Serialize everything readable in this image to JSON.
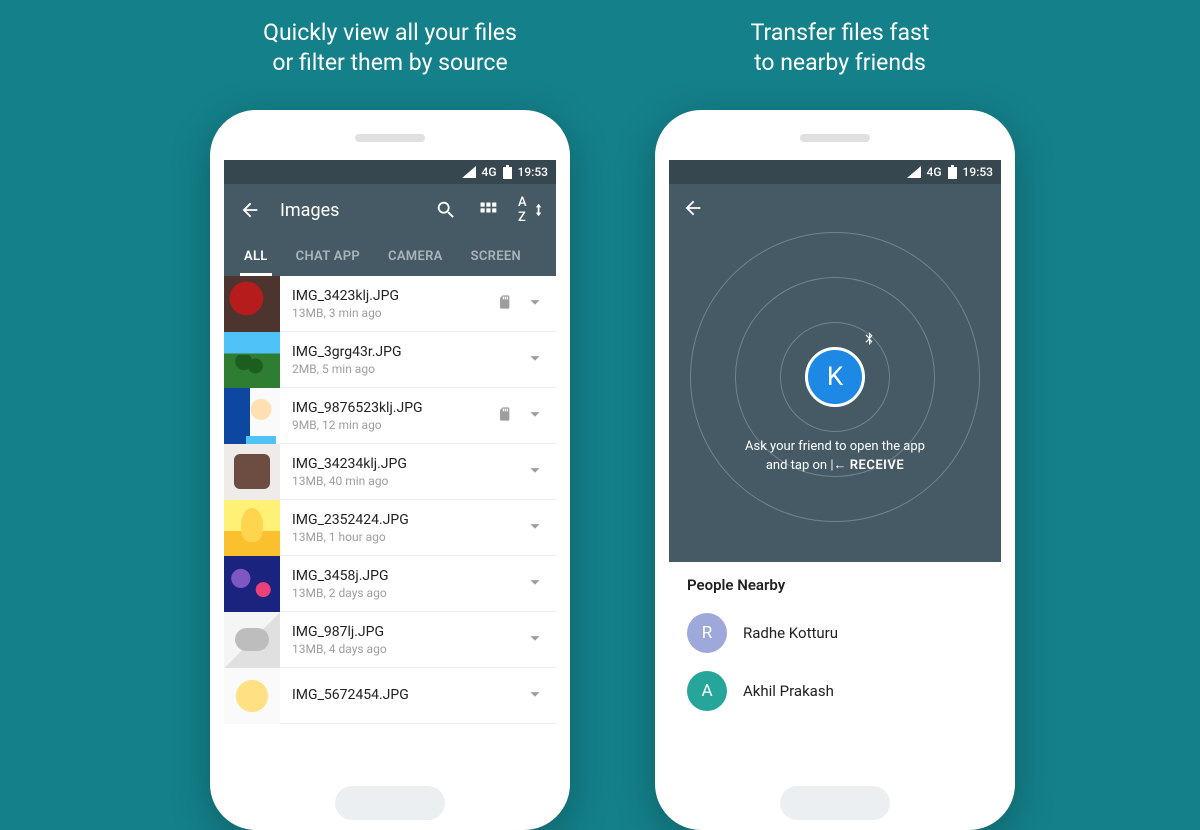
{
  "headlines": {
    "left_l1": "Quickly view all your files",
    "left_l2": "or filter them by source",
    "right_l1": "Transfer files fast",
    "right_l2": "to nearby friends"
  },
  "status": {
    "net": "4G",
    "time": "19:53"
  },
  "phone1": {
    "title": "Images",
    "sort_label": "A Z",
    "tabs": [
      {
        "label": "ALL",
        "active": true
      },
      {
        "label": "CHAT APP",
        "active": false
      },
      {
        "label": "CAMERA",
        "active": false
      },
      {
        "label": "SCREEN",
        "active": false
      }
    ],
    "files": [
      {
        "name": "IMG_3423klj.JPG",
        "sub": "13MB, 3 min ago",
        "sd": true
      },
      {
        "name": "IMG_3grg43r.JPG",
        "sub": "2MB, 5 min ago",
        "sd": false
      },
      {
        "name": "IMG_9876523klj.JPG",
        "sub": "9MB, 12 min ago",
        "sd": true
      },
      {
        "name": "IMG_34234klj.JPG",
        "sub": "13MB, 40 min ago",
        "sd": false
      },
      {
        "name": "IMG_2352424.JPG",
        "sub": "13MB, 1 hour ago",
        "sd": false
      },
      {
        "name": "IMG_3458j.JPG",
        "sub": "13MB, 2 days ago",
        "sd": false
      },
      {
        "name": "IMG_987lj.JPG",
        "sub": "13MB, 4 days ago",
        "sd": false
      },
      {
        "name": "IMG_5672454.JPG",
        "sub": "",
        "sd": false
      }
    ]
  },
  "phone2": {
    "me_initial": "K",
    "hint_l1": "Ask your friend to open the app",
    "hint_l2_prefix": "and tap on ",
    "hint_receive": "RECEIVE",
    "nearby_title": "People Nearby",
    "people": [
      {
        "initial": "R",
        "name": "Radhe Kotturu",
        "color": "#9fa8da"
      },
      {
        "initial": "A",
        "name": "Akhil Prakash",
        "color": "#26a69a"
      }
    ]
  }
}
